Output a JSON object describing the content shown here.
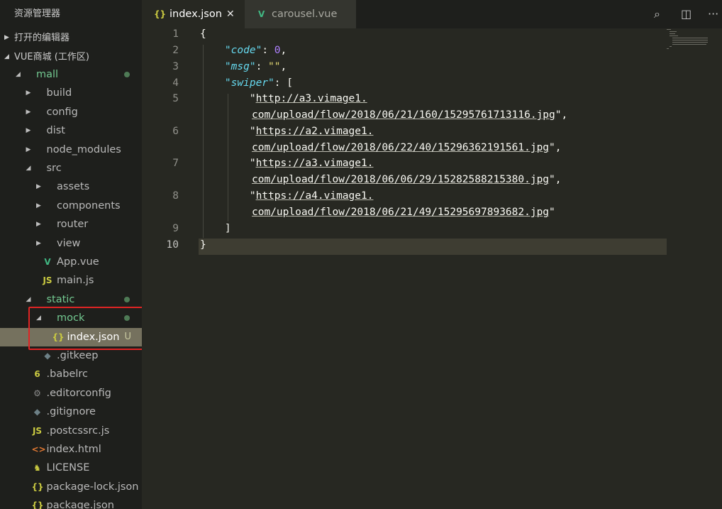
{
  "sidebar": {
    "title": "资源管理器",
    "sections": [
      {
        "label": "打开的编辑器",
        "expanded": false
      },
      {
        "label": "VUE商城 (工作区)",
        "expanded": true
      }
    ],
    "tree": [
      {
        "label": "mall",
        "kind": "folder-open",
        "depth": 0,
        "status": "dot",
        "green": true
      },
      {
        "label": "build",
        "kind": "folder",
        "depth": 1
      },
      {
        "label": "config",
        "kind": "folder",
        "depth": 1
      },
      {
        "label": "dist",
        "kind": "folder",
        "depth": 1
      },
      {
        "label": "node_modules",
        "kind": "folder",
        "depth": 1
      },
      {
        "label": "src",
        "kind": "folder-open",
        "depth": 1
      },
      {
        "label": "assets",
        "kind": "folder",
        "depth": 2
      },
      {
        "label": "components",
        "kind": "folder",
        "depth": 2
      },
      {
        "label": "router",
        "kind": "folder",
        "depth": 2
      },
      {
        "label": "view",
        "kind": "folder",
        "depth": 2
      },
      {
        "label": "App.vue",
        "kind": "file",
        "icon": "vue-icon",
        "glyph": "V",
        "icolor": "#41b883",
        "depth": 2
      },
      {
        "label": "main.js",
        "kind": "file",
        "icon": "js-icon",
        "glyph": "JS",
        "icolor": "#cbcb41",
        "depth": 2
      },
      {
        "label": "static",
        "kind": "folder-open",
        "depth": 1,
        "status": "dot",
        "green": true
      },
      {
        "label": "mock",
        "kind": "folder-open",
        "depth": 2,
        "status": "dot",
        "green": true
      },
      {
        "label": "index.json",
        "kind": "file",
        "icon": "json-icon",
        "glyph": "{}",
        "icolor": "#cbcb41",
        "depth": 3,
        "status": "U",
        "selected": true
      },
      {
        "label": ".gitkeep",
        "kind": "file",
        "icon": "git-icon",
        "glyph": "◆",
        "icolor": "#6d8086",
        "depth": 2
      },
      {
        "label": ".babelrc",
        "kind": "file",
        "icon": "babel-icon",
        "glyph": "6",
        "icolor": "#cbcb41",
        "depth": 1
      },
      {
        "label": ".editorconfig",
        "kind": "file",
        "icon": "gear-icon",
        "glyph": "⚙",
        "icolor": "#8a8a8a",
        "depth": 1
      },
      {
        "label": ".gitignore",
        "kind": "file",
        "icon": "git-icon",
        "glyph": "◆",
        "icolor": "#6d8086",
        "depth": 1
      },
      {
        "label": ".postcssrc.js",
        "kind": "file",
        "icon": "js-icon",
        "glyph": "JS",
        "icolor": "#cbcb41",
        "depth": 1
      },
      {
        "label": "index.html",
        "kind": "file",
        "icon": "html-icon",
        "glyph": "<>",
        "icolor": "#e37933",
        "depth": 1
      },
      {
        "label": "LICENSE",
        "kind": "file",
        "icon": "license-icon",
        "glyph": "♞",
        "icolor": "#cbcb41",
        "depth": 1
      },
      {
        "label": "package-lock.json",
        "kind": "file",
        "icon": "json-icon",
        "glyph": "{}",
        "icolor": "#cbcb41",
        "depth": 1
      },
      {
        "label": "package.json",
        "kind": "file",
        "icon": "json-icon",
        "glyph": "{}",
        "icolor": "#cbcb41",
        "depth": 1
      }
    ]
  },
  "tabs": {
    "active": {
      "label": "index.json",
      "icon": "{}",
      "close": "✕"
    },
    "inactive": {
      "label": "carousel.vue",
      "icon": "V"
    }
  },
  "actions": {
    "search": "⌕",
    "split": "◫",
    "more": "···"
  },
  "editor": {
    "line_numbers": [
      "1",
      "2",
      "3",
      "4",
      "5",
      "6",
      "7",
      "8",
      "9",
      "10"
    ],
    "code": {
      "open_brace": "{",
      "close_brace": "}",
      "key_code": "\"code\"",
      "val_code": "0",
      "key_msg": "\"msg\"",
      "val_msg": "\"\"",
      "key_swiper": "\"swiper\"",
      "open_bracket": "[",
      "close_bracket": "]",
      "colon": ": ",
      "comma": ",",
      "quote": "\"",
      "urls": [
        {
          "part1": "http://a3.vimage1.",
          "part2": "com/upload/flow/2018/06/21/160/15295761713116.jpg",
          "trail": ","
        },
        {
          "part1": "https://a2.vimage1.",
          "part2": "com/upload/flow/2018/06/22/40/15296362191561.jpg",
          "trail": ","
        },
        {
          "part1": "https://a3.vimage1.",
          "part2": "com/upload/flow/2018/06/06/29/15282588215380.jpg",
          "trail": ","
        },
        {
          "part1": "https://a4.vimage1.",
          "part2": "com/upload/flow/2018/06/21/49/15295697893682.jpg",
          "trail": ""
        }
      ]
    }
  }
}
